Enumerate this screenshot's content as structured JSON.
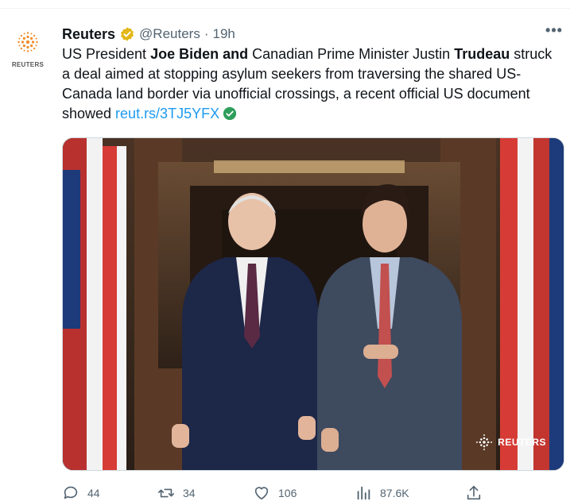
{
  "tweet": {
    "author": {
      "display_name": "Reuters",
      "handle": "@Reuters",
      "avatar_text": "REUTERS",
      "verified": true,
      "verified_color": "#e2b719"
    },
    "separator": "·",
    "time": "19h",
    "more_icon": "more-horizontal-icon",
    "text": {
      "p1": "US President ",
      "b1": "Joe Biden and",
      "p2": " Canadian Prime Minister Justin ",
      "b2": "Trudeau",
      "p3": " struck a deal aimed at stopping asylum seekers from traversing the shared US-Canada land border via unofficial crossings, a recent official US document showed ",
      "link": "reut.rs/3TJ5YFX"
    },
    "media": {
      "watermark": "REUTERS"
    },
    "actions": {
      "replies": "44",
      "retweets": "34",
      "likes": "106",
      "views": "87.6K"
    },
    "colors": {
      "link": "#1d9bf0",
      "muted": "#536471",
      "text": "#0f1419"
    }
  }
}
